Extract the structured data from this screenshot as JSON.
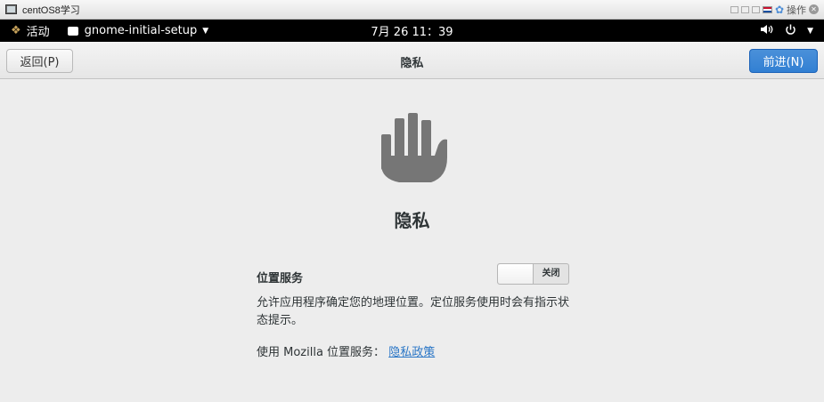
{
  "vm_window": {
    "title": "centOS8学习",
    "operations_label": "操作"
  },
  "topbar": {
    "activities_label": "活动",
    "app_name": "gnome-initial-setup",
    "clock": "7月 26  11：39",
    "icons": [
      "volume-icon",
      "power-icon",
      "menu-caret-icon"
    ]
  },
  "headerbar": {
    "back_label": "返回(P)",
    "title": "隐私",
    "next_label": "前进(N)"
  },
  "page": {
    "icon": "hand-privacy-icon",
    "title": "隐私",
    "location_service_label": "位置服务",
    "location_switch": {
      "state_label": "关闭",
      "on": false
    },
    "description": "允许应用程序确定您的地理位置。定位服务使用时会有指示状态提示。",
    "mozilla_text": "使用 Mozilla 位置服务：",
    "privacy_policy_link": "隐私政策"
  },
  "colors": {
    "accent": "#3584e4",
    "link": "#2a76c6",
    "icon_gray": "#767676"
  }
}
